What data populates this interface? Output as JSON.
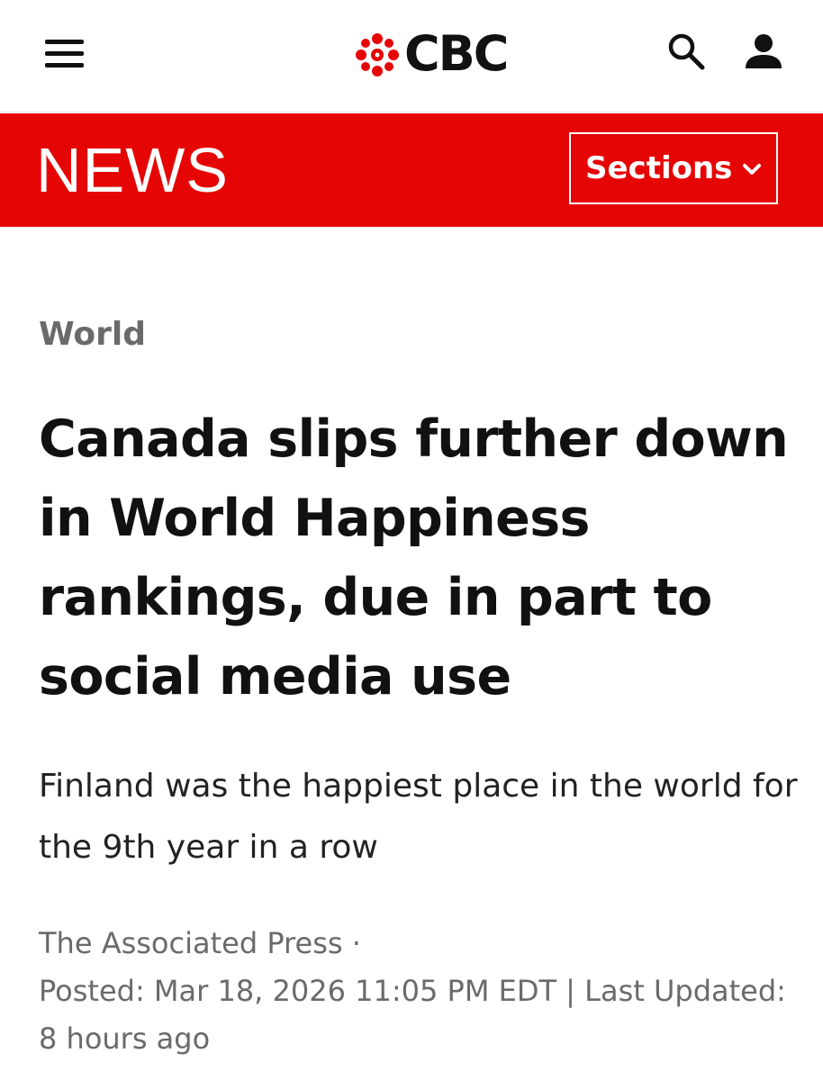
{
  "header": {
    "menu_icon": "hamburger-menu-icon",
    "logo_text": "CBC",
    "search_icon": "search-icon",
    "account_icon": "user-account-icon",
    "brand_color": "#e60505"
  },
  "newsbar": {
    "wordmark": "NEWS",
    "sections_label": "Sections",
    "sections_icon": "chevron-down-icon"
  },
  "article": {
    "category": "World",
    "headline": "Canada slips further down in World Happiness rankings, due in part to social media use",
    "deck": "Finland was the happiest place in the world for the 9th year in a row",
    "author": "The Associated Press",
    "separator": "·",
    "posted_label": "Posted:",
    "posted_date": "Mar 18, 2026 11:05 PM EDT",
    "pipe": "|",
    "updated_label": "Last Updated:",
    "updated_value": "8 hours ago"
  }
}
